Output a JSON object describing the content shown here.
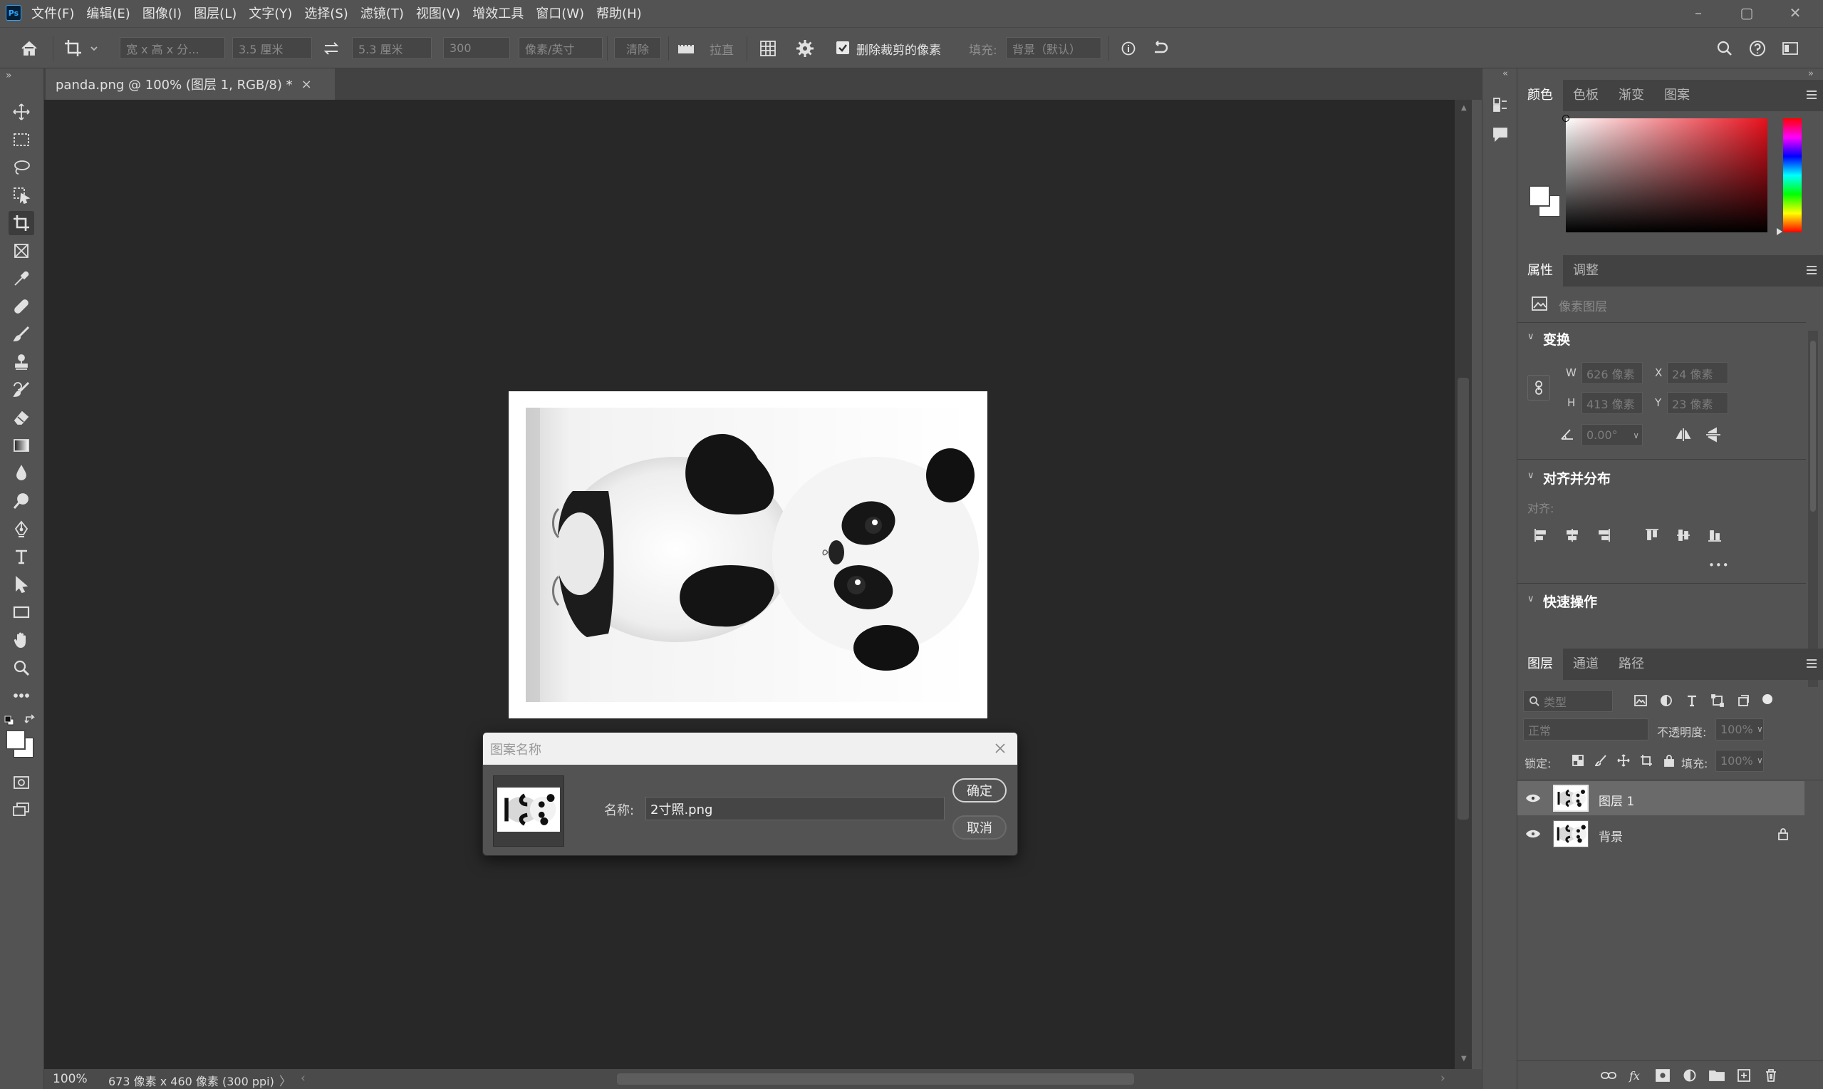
{
  "app": {
    "logo": "Ps"
  },
  "menu": [
    "文件(F)",
    "编辑(E)",
    "图像(I)",
    "图层(L)",
    "文字(Y)",
    "选择(S)",
    "滤镜(T)",
    "视图(V)",
    "增效工具",
    "窗口(W)",
    "帮助(H)"
  ],
  "window_controls": {
    "minimize": "–",
    "maximize": "▢",
    "close": "✕"
  },
  "options": {
    "ratio": "宽 x 高 x 分...",
    "width": "3.5 厘米",
    "height": "5.3 厘米",
    "resolution": "300",
    "unit": "像素/英寸",
    "clear": "清除",
    "straighten": "拉直",
    "delete_cropped": "删除裁剪的像素",
    "delete_cropped_checked": true,
    "fill_label": "填充:",
    "fill_value": "背景（默认）"
  },
  "document": {
    "tab_title": "panda.png @ 100% (图层 1, RGB/8) *",
    "tab_close": "×"
  },
  "status": {
    "zoom": "100%",
    "info": "673 像素 x 460 像素 (300 ppi)",
    "arrow": "〉",
    "left_arrow": "‹",
    "right_arrow": "›"
  },
  "color_panel": {
    "tabs": [
      "颜色",
      "色板",
      "渐变",
      "图案"
    ],
    "active": 0,
    "hue_colors": [
      "#ff0000",
      "#ff00ff",
      "#0000ff",
      "#00ffff",
      "#00ff00",
      "#ffff00",
      "#ff0000"
    ]
  },
  "properties_panel": {
    "tabs": [
      "属性",
      "调整"
    ],
    "active": 0,
    "layer_type": "像素图层",
    "transform_title": "变换",
    "w_label": "W",
    "w_value": "626 像素",
    "x_label": "X",
    "x_value": "24 像素",
    "h_label": "H",
    "h_value": "413 像素",
    "y_label": "Y",
    "y_value": "23 像素",
    "angle_value": "0.00°",
    "align_title": "对齐并分布",
    "align_label": "对齐:",
    "more": "•••",
    "quick_title": "快速操作"
  },
  "layers_panel": {
    "tabs": [
      "图层",
      "通道",
      "路径"
    ],
    "active": 0,
    "filter_placeholder": "类型",
    "blend_mode": "正常",
    "opacity_label": "不透明度:",
    "opacity_value": "100%",
    "lock_label": "锁定:",
    "fill_label": "填充:",
    "fill_value": "100%",
    "layers": [
      {
        "name": "图层 1",
        "selected": true,
        "locked": false
      },
      {
        "name": "背景",
        "selected": false,
        "locked": true
      }
    ]
  },
  "dialog": {
    "title": "图案名称",
    "name_label": "名称:",
    "name_value": "2寸照.png",
    "ok_label": "确定",
    "cancel_label": "取消"
  }
}
